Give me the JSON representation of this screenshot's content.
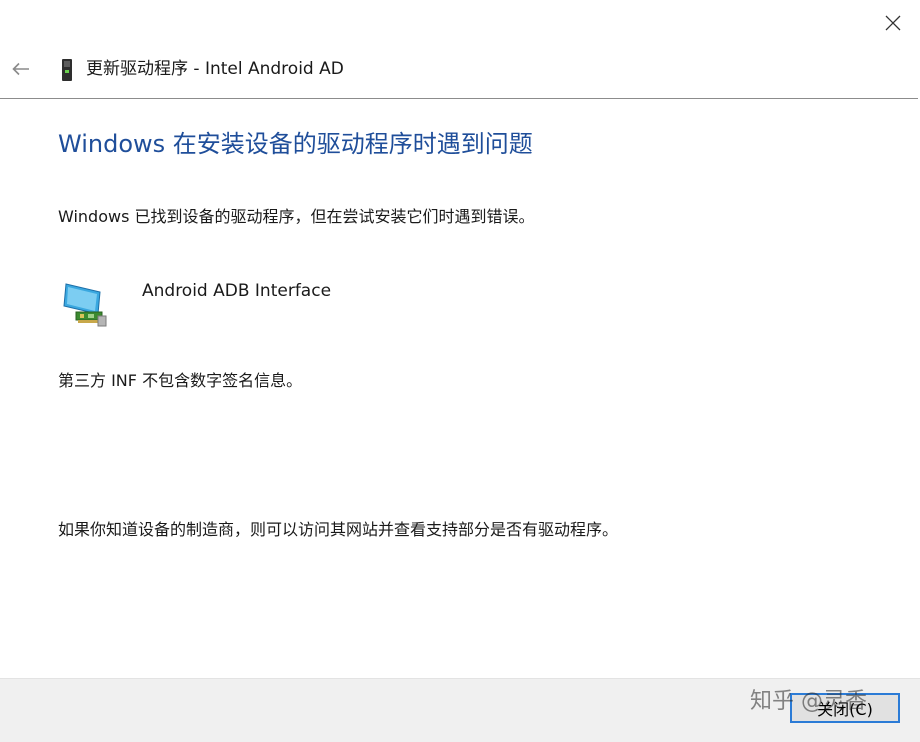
{
  "window": {
    "title": "更新驱动程序 - Intel Android AD",
    "close_icon": "close-icon",
    "back_icon": "back-arrow-icon"
  },
  "content": {
    "heading": "Windows 在安装设备的驱动程序时遇到问题",
    "found_message": "Windows 已找到设备的驱动程序，但在尝试安装它们时遇到错误。",
    "device_name": "Android ADB Interface",
    "device_icon": "network-adapter-icon",
    "error_detail": "第三方 INF 不包含数字签名信息。",
    "manufacturer_hint": "如果你知道设备的制造商，则可以访问其网站并查看支持部分是否有驱动程序。"
  },
  "footer": {
    "close_label": "关闭(C)"
  },
  "watermark": "知乎 @灵香",
  "colors": {
    "heading": "#1f4e9a",
    "button_border": "#2b7bd6",
    "footer_bg": "#f0f0f0",
    "divider": "#8c8c8c"
  }
}
